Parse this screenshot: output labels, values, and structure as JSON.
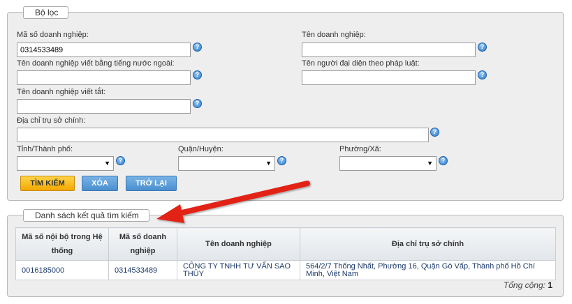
{
  "filter": {
    "legend": "Bộ lọc",
    "tax_code_label": "Mã số doanh nghiệp:",
    "tax_code_value": "0314533489",
    "company_name_label": "Tên doanh nghiệp:",
    "foreign_name_label": "Tên doanh nghiệp viết bằng tiếng nước ngoài:",
    "legal_rep_label": "Tên người đại diện theo pháp luật:",
    "short_name_label": "Tên doanh nghiệp viết tắt:",
    "address_label": "Địa chỉ trụ sở chính:",
    "province_label": "Tỉnh/Thành phố:",
    "district_label": "Quận/Huyện:",
    "ward_label": "Phường/Xã:",
    "help_glyph": "?",
    "dropdown_glyph": "▼"
  },
  "buttons": {
    "search": "TÌM KIẾM",
    "clear": "XÓA",
    "back": "TRỞ LẠI"
  },
  "results": {
    "legend": "Danh sách kết quả tìm kiếm",
    "columns": [
      "Mã số nội bộ trong Hệ thống",
      "Mã số doanh nghiệp",
      "Tên doanh nghiệp",
      "Địa chỉ trụ sở chính"
    ],
    "rows": [
      [
        "0016185000",
        "0314533489",
        "CÔNG TY TNHH TƯ VẤN SAO THỦY",
        "564/2/7 Thống Nhất, Phường 16, Quận Gò Vấp, Thành phố Hồ Chí Minh, Việt Nam"
      ]
    ],
    "total_label": "Tổng cộng:",
    "total_value": "1"
  },
  "colors": {
    "annotation_arrow": "#e32119",
    "primary_button": "#f5b300",
    "secondary_button": "#5b9bd5"
  }
}
